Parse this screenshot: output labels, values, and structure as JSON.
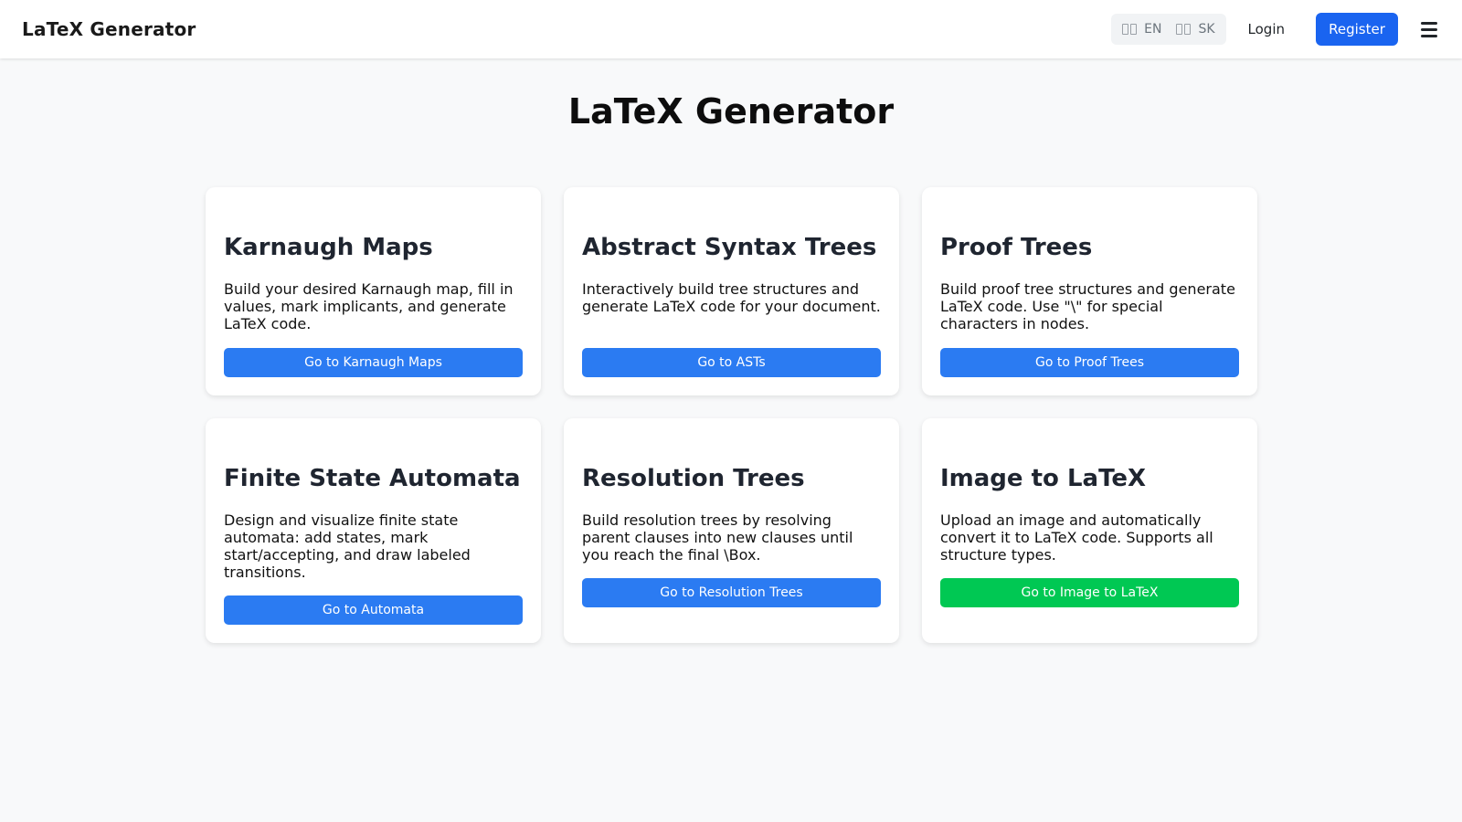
{
  "nav": {
    "brand": "LaTeX Generator",
    "lang_en": "EN",
    "lang_sk": "SK",
    "login": "Login",
    "register": "Register"
  },
  "main": {
    "title": "LaTeX Generator"
  },
  "cards": [
    {
      "title": "Karnaugh Maps",
      "text": "Build your desired Karnaugh map, fill in values, mark implicants, and generate LaTeX code.",
      "button": "Go to Karnaugh Maps"
    },
    {
      "title": "Abstract Syntax Trees",
      "text": "Interactively build tree structures and generate LaTeX code for your document.",
      "button": "Go to ASTs"
    },
    {
      "title": "Proof Trees",
      "text": "Build proof tree structures and generate LaTeX code. Use \"\\\" for special characters in nodes.",
      "button": "Go to Proof Trees"
    },
    {
      "title": "Finite State Automata",
      "text": "Design and visualize finite state automata: add states, mark start/accepting, and draw labeled transitions.",
      "button": "Go to Automata"
    },
    {
      "title": "Resolution Trees",
      "text": "Build resolution trees by resolving parent clauses into new clauses until you reach the final \\Box.",
      "button": "Go to Resolution Trees"
    },
    {
      "title": "Image to LaTeX",
      "text": "Upload an image and automatically convert it to LaTeX code. Supports all structure types.",
      "button": "Go to Image to LaTeX"
    }
  ],
  "colors": {
    "primary": "#2b7bf2",
    "register": "#1a64f0",
    "success": "#00c853"
  },
  "icons": {
    "flag": "flag-icon",
    "menu": "hamburger-menu-icon"
  }
}
